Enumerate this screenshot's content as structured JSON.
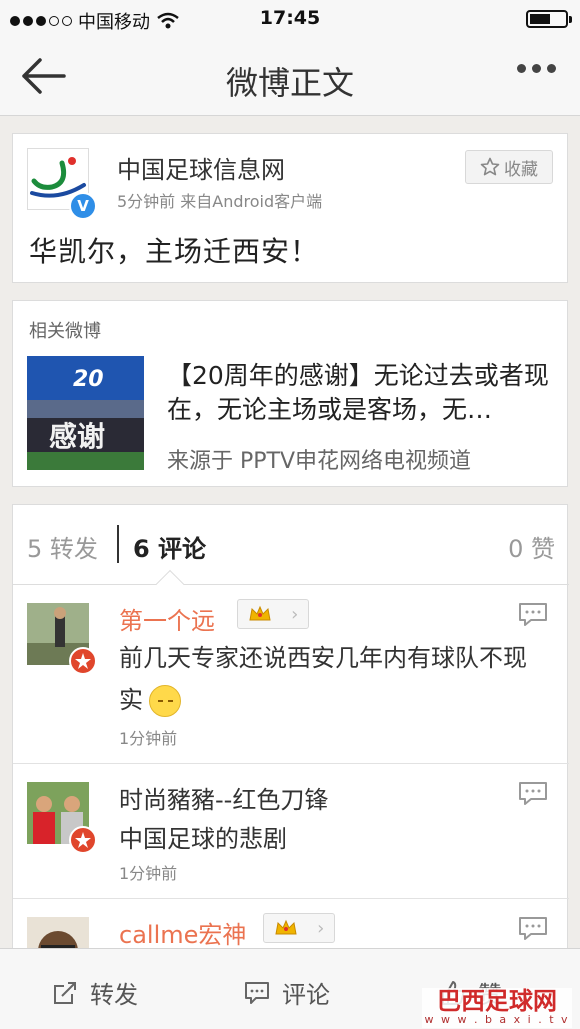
{
  "status_bar": {
    "carrier": "中国移动",
    "time": "17:45"
  },
  "nav": {
    "title": "微博正文"
  },
  "post": {
    "author": "中国足球信息网",
    "meta": "5分钟前  来自Android客户端",
    "favorite_label": "收藏",
    "text": "华凯尔，主场迁西安！",
    "verified_mark": "V"
  },
  "related": {
    "header": "相关微博",
    "thumb_number": "20",
    "thumb_text": "感谢",
    "title": "【20周年的感谢】无论过去或者现在，无论主场或是客场，无…",
    "source": "来源于 PPTV申花网络电视频道"
  },
  "comments": {
    "tab_reposts": "5 转发",
    "tab_comments": "6 评论",
    "tab_likes": "0 赞",
    "items": [
      {
        "name": "第一个远",
        "text": "前几天专家还说西安几年内有球队不现实",
        "time": "1分钟前"
      },
      {
        "name": "时尚豬豬--红色刀锋",
        "text": "中国足球的悲剧",
        "time": "1分钟前"
      },
      {
        "name": "callme宏神"
      }
    ]
  },
  "toolbar": {
    "repost": "转发",
    "comment": "评论",
    "like": "赞"
  },
  "watermark": {
    "cn": "巴西足球网",
    "url": "w w w . b a x i . t v"
  }
}
